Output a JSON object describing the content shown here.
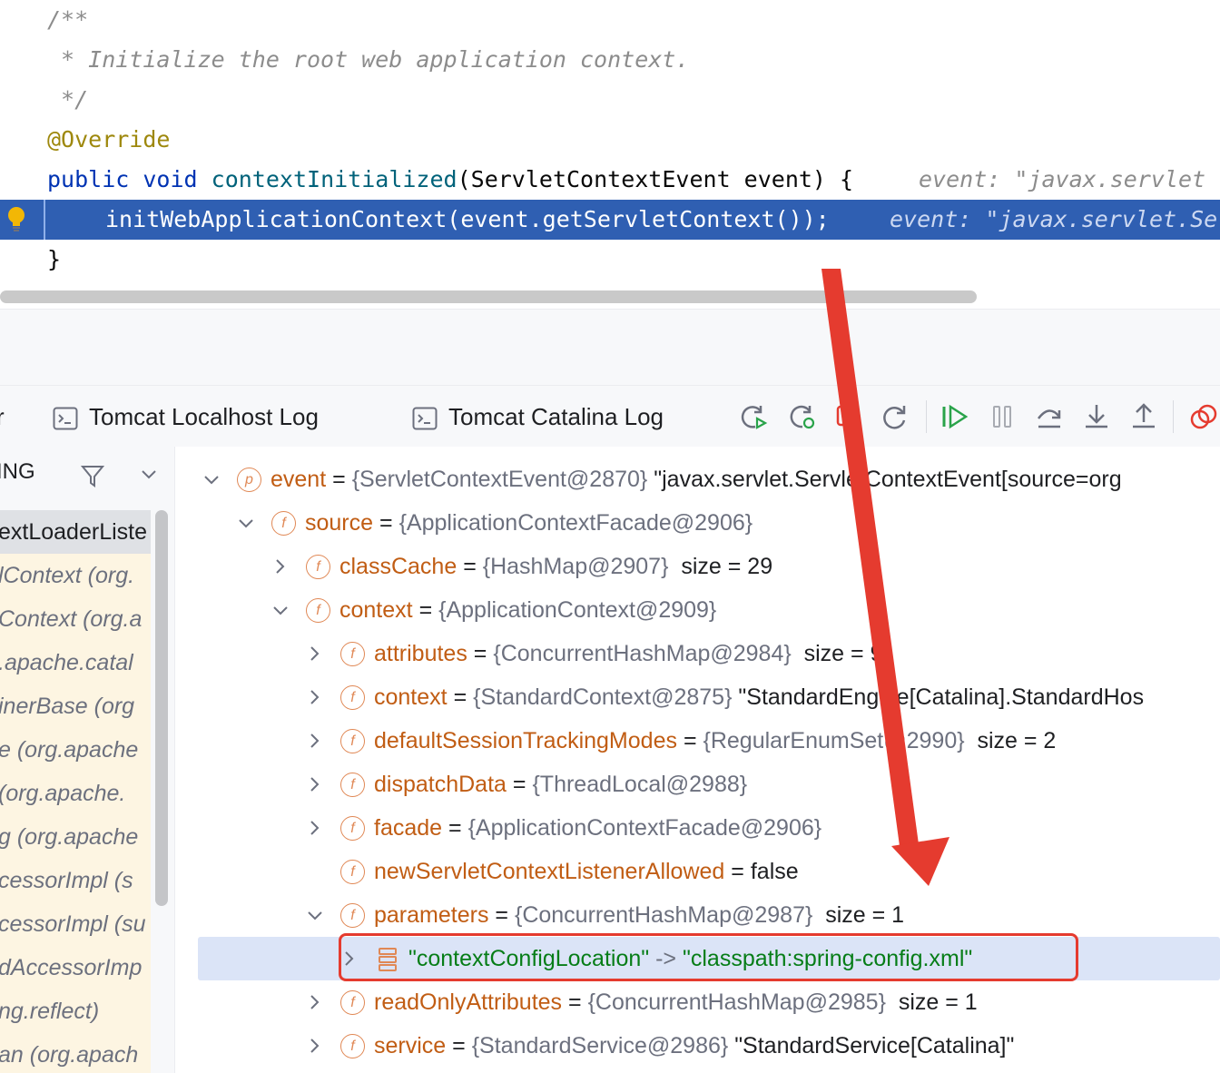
{
  "editor": {
    "lines": {
      "c1": "/**",
      "c2": " * Initialize the root web application context.",
      "c3": " */",
      "annotation": "@Override",
      "sig_public": "public",
      "sig_void": "void",
      "sig_method": "contextInitialized",
      "sig_params": "(ServletContextEvent event) {",
      "sig_hint": "event: \"javax.servlet",
      "exec_code": "initWebApplicationContext(event.getServletContext());",
      "exec_hint": "event: \"javax.servlet.Se",
      "close": "}"
    }
  },
  "toolbar": {
    "tab_partial": "r",
    "tab_localhost_log": "Tomcat Localhost Log",
    "tab_catalina_log": "Tomcat Catalina Log",
    "buttons": [
      "rerun-icon",
      "debug-rerun-icon",
      "stop-icon",
      "refresh-icon",
      "resume-icon",
      "pause-icon",
      "step-over-icon",
      "step-into-icon",
      "step-out-icon",
      "mute-breakpoints-icon"
    ]
  },
  "frames": {
    "thread_label": "ING",
    "items": [
      "extLoaderListe",
      "lContext (org.",
      "Context (org.a",
      ".apache.catal",
      "inerBase (org",
      "e (org.apache",
      " (org.apache.",
      "g (org.apache",
      "cessorImpl (s",
      "cessorImpl (su",
      "dAccessorImp",
      "ng.reflect)",
      "an (org.apach"
    ]
  },
  "variables": {
    "event": {
      "name": "event",
      "ref": "{ServletContextEvent@2870}",
      "value": "\"javax.servlet.ServletContextEvent[source=org"
    },
    "source": {
      "name": "source",
      "ref": "{ApplicationContextFacade@2906}"
    },
    "classCache": {
      "name": "classCache",
      "ref": "{HashMap@2907}",
      "extra": "size = 29"
    },
    "context_outer": {
      "name": "context",
      "ref": "{ApplicationContext@2909}"
    },
    "attributes": {
      "name": "attributes",
      "ref": "{ConcurrentHashMap@2984}",
      "extra": "size = 9"
    },
    "context_inner": {
      "name": "context",
      "ref": "{StandardContext@2875}",
      "value": "\"StandardEngine[Catalina].StandardHos"
    },
    "defaultSessionTrackingModes": {
      "name": "defaultSessionTrackingModes",
      "ref": "{RegularEnumSet@2990}",
      "extra": "size = 2"
    },
    "dispatchData": {
      "name": "dispatchData",
      "ref": "{ThreadLocal@2988}"
    },
    "facade": {
      "name": "facade",
      "ref": "{ApplicationContextFacade@2906}"
    },
    "newServletContextListenerAllowed": {
      "name": "newServletContextListenerAllowed",
      "value": "false"
    },
    "parameters": {
      "name": "parameters",
      "ref": "{ConcurrentHashMap@2987}",
      "extra": "size = 1"
    },
    "entry": {
      "key": "\"contextConfigLocation\"",
      "arrow": "->",
      "val": "\"classpath:spring-config.xml\""
    },
    "readOnlyAttributes": {
      "name": "readOnlyAttributes",
      "ref": "{ConcurrentHashMap@2985}",
      "extra": "size = 1"
    },
    "service": {
      "name": "service",
      "ref": "{StandardService@2986}",
      "value": "\"StandardService[Catalina]\""
    },
    "eq": "=",
    "badge_p": "p",
    "badge_f": "f"
  },
  "colors": {
    "annotation_red": "#e53b2f",
    "execution_line": "#2f5fb2",
    "selected_row": "#dbe4f7"
  }
}
